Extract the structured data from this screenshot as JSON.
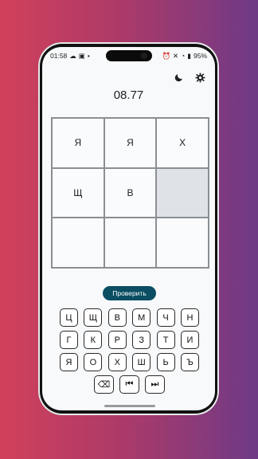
{
  "status_bar": {
    "time": "01:58",
    "battery": "95%"
  },
  "header": {
    "theme_icon": "moon-icon",
    "settings_icon": "gear-icon"
  },
  "timer": "08.77",
  "grid": {
    "cells": [
      "Я",
      "Я",
      "Х",
      "Щ",
      "В",
      "",
      "",
      "",
      ""
    ],
    "active_cell": 5
  },
  "check_button": "Проверить",
  "keyboard": {
    "rows": [
      [
        "Ц",
        "Щ",
        "В",
        "М",
        "Ч",
        "Н"
      ],
      [
        "Г",
        "К",
        "Р",
        "З",
        "Т",
        "И"
      ],
      [
        "Я",
        "О",
        "Х",
        "Ш",
        "Ь",
        "Ъ"
      ]
    ],
    "controls": [
      {
        "icon": "backspace-icon",
        "glyph": "⌫"
      },
      {
        "icon": "skip-back-icon",
        "glyph": "⏮"
      },
      {
        "icon": "skip-forward-icon",
        "glyph": "⏭"
      }
    ]
  },
  "colors": {
    "primary": "#0b4e63",
    "active_cell": "#dfe3e7"
  }
}
